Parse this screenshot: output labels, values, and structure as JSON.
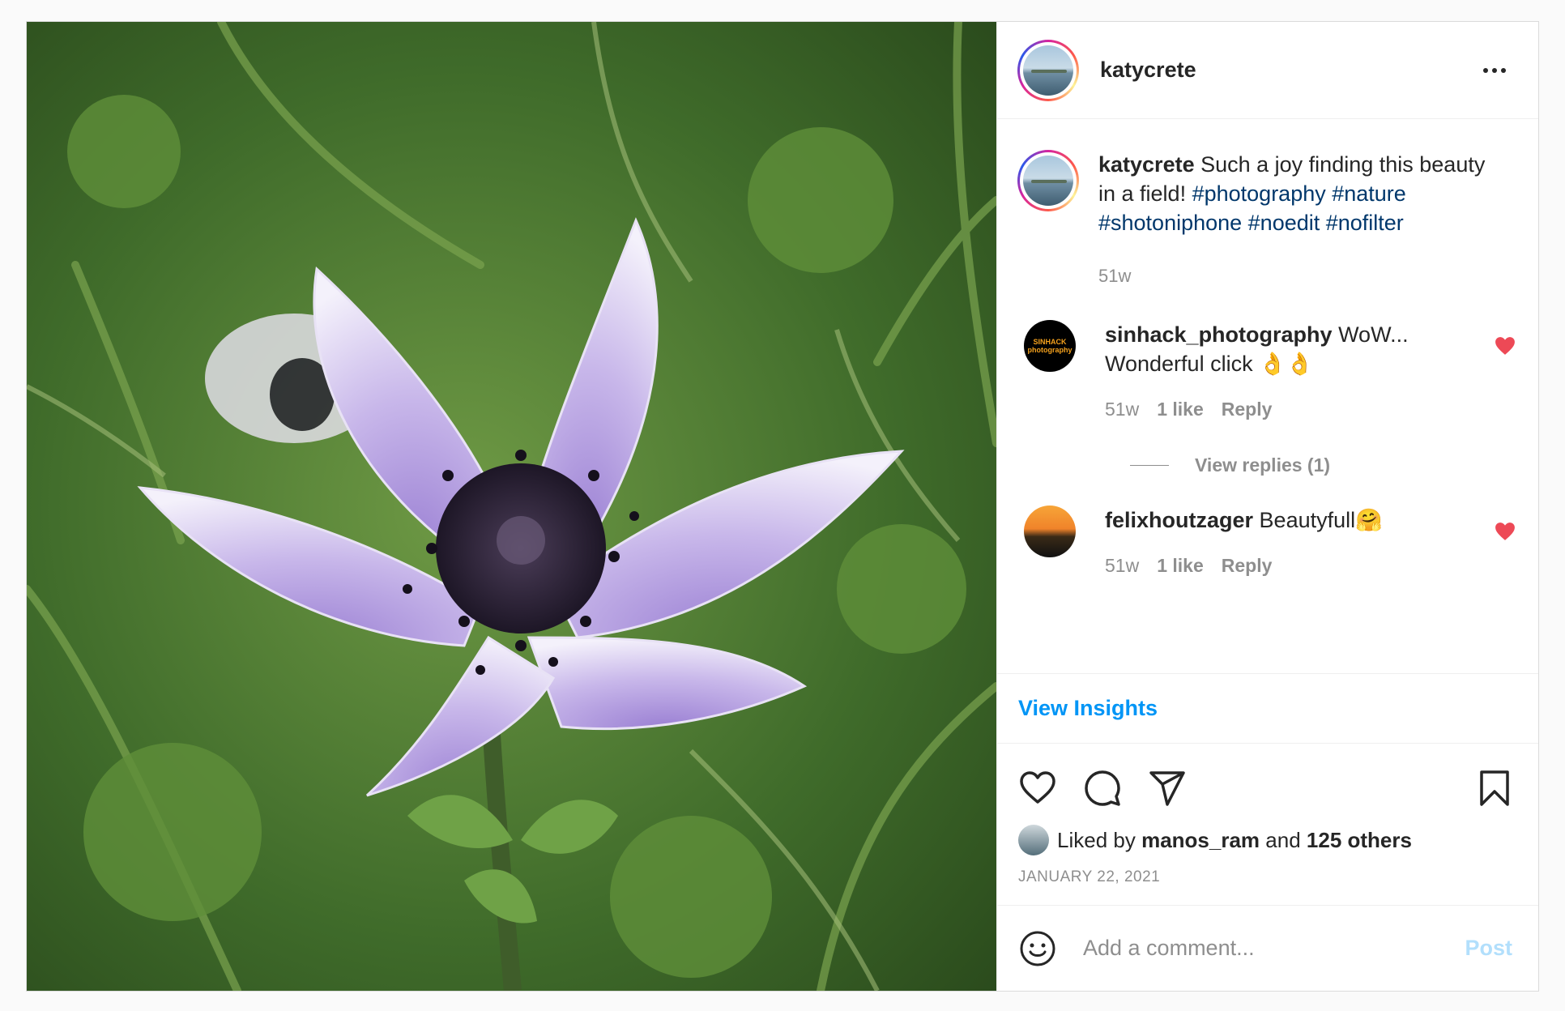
{
  "post": {
    "username": "katycrete",
    "caption_text": "Such a joy finding this beauty in a field!",
    "hashtags": "#photography #nature #shotoniphone #noedit #nofilter",
    "caption_age": "51w",
    "image_alt": "purple anemone flower"
  },
  "comments": [
    {
      "username": "sinhack_photography",
      "text": "WoW... Wonderful click 👌👌",
      "age": "51w",
      "likes": "1 like",
      "reply_label": "Reply",
      "view_replies": "View replies (1)",
      "avatar_text": "SINHACK photography",
      "liked": true
    },
    {
      "username": "felixhoutzager",
      "text": "Beautyfull🤗",
      "age": "51w",
      "likes": "1 like",
      "reply_label": "Reply",
      "liked": true
    }
  ],
  "insights_label": "View Insights",
  "likes": {
    "prefix": "Liked by",
    "user": "manos_ram",
    "middle": "and",
    "others": "125 others"
  },
  "date": "JANUARY 22, 2021",
  "add_comment": {
    "placeholder": "Add a comment...",
    "post_label": "Post"
  },
  "icons": {
    "more": "more-options-icon",
    "like": "heart-icon",
    "comment": "comment-icon",
    "share": "share-icon",
    "save": "bookmark-icon",
    "emoji": "emoji-icon"
  },
  "colors": {
    "link_blue": "#0095f6",
    "hashtag": "#00376b",
    "like_red": "#ed4956",
    "muted": "#8e8e8e"
  }
}
